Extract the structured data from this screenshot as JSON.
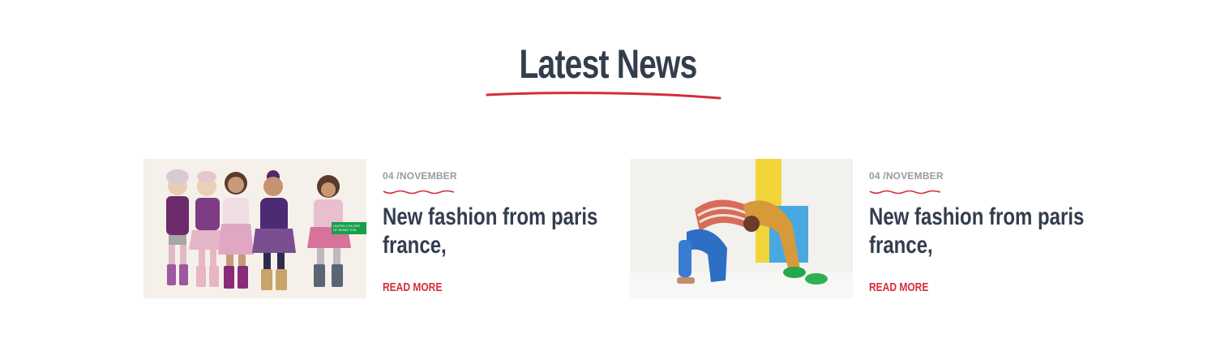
{
  "section": {
    "title": "Latest News",
    "accent_color": "#d42d3a",
    "title_color": "#333d4e"
  },
  "news": [
    {
      "date": "04 /NOVEMBER",
      "title": "New fashion from paris france,",
      "read_more": "READ MORE",
      "image": {
        "name": "kids-in-winter-outfits-photo",
        "brand_tag": "UNITED COLORS OF BENETTON."
      }
    },
    {
      "date": "04 /NOVEMBER",
      "title": "New fashion from paris france,",
      "read_more": "READ MORE",
      "image": {
        "name": "kid-bending-backwards-photo"
      }
    }
  ]
}
